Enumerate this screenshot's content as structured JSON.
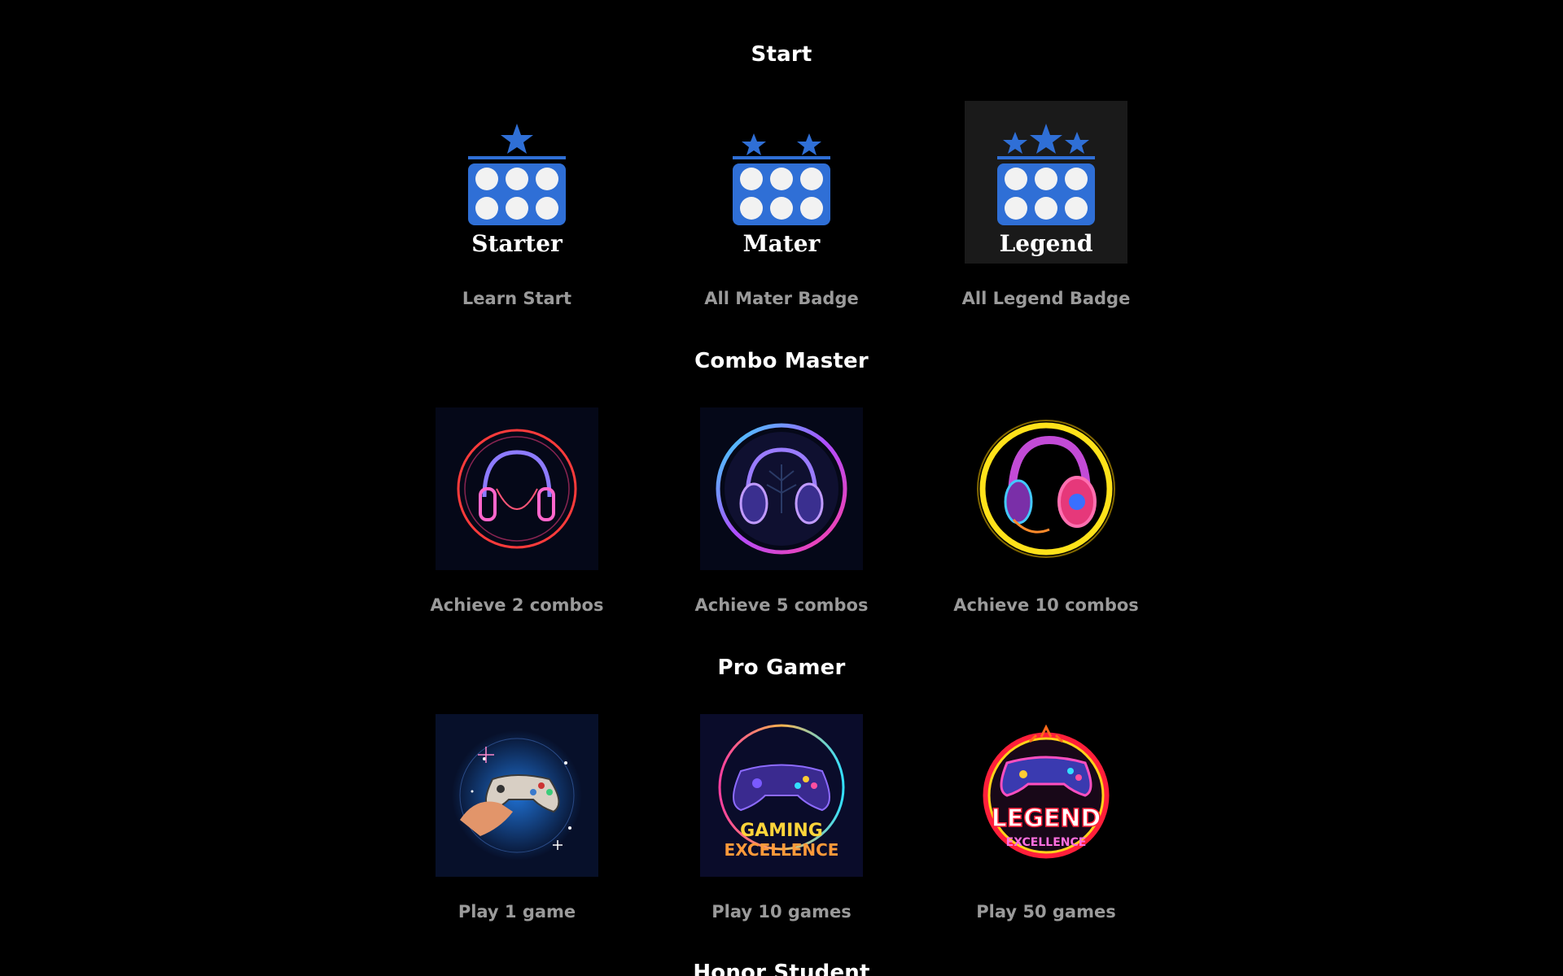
{
  "sections": [
    {
      "title": "Start",
      "badges": [
        {
          "caption": "Learn Start",
          "icon": "starter-badge-icon",
          "label": "Starter"
        },
        {
          "caption": "All Mater Badge",
          "icon": "mater-badge-icon",
          "label": "Mater"
        },
        {
          "caption": "All Legend Badge",
          "icon": "legend-badge-icon",
          "label": "Legend"
        }
      ]
    },
    {
      "title": "Combo Master",
      "badges": [
        {
          "caption": "Achieve 2 combos",
          "icon": "neon-headphones-red-icon"
        },
        {
          "caption": "Achieve 5 combos",
          "icon": "neon-headphones-rainbow-icon"
        },
        {
          "caption": "Achieve 10 combos",
          "icon": "neon-headphones-gold-icon"
        }
      ]
    },
    {
      "title": "Pro Gamer",
      "badges": [
        {
          "caption": "Play 1 game",
          "icon": "hand-gamepad-icon"
        },
        {
          "caption": "Play 10 games",
          "icon": "gaming-excellence-icon",
          "label_line1": "GAMING",
          "label_line2": "EXCELLENCE"
        },
        {
          "caption": "Play 50 games",
          "icon": "legend-excellence-icon",
          "label_line1": "LEGEND",
          "label_line2": "EXCELLENCE"
        }
      ]
    },
    {
      "title": "Honor Student"
    }
  ],
  "colors": {
    "background": "#000000",
    "title": "#ffffff",
    "caption": "#9a9a9a",
    "badge_blue": "#2f6fd6",
    "ball_white": "#f2f2f2"
  }
}
